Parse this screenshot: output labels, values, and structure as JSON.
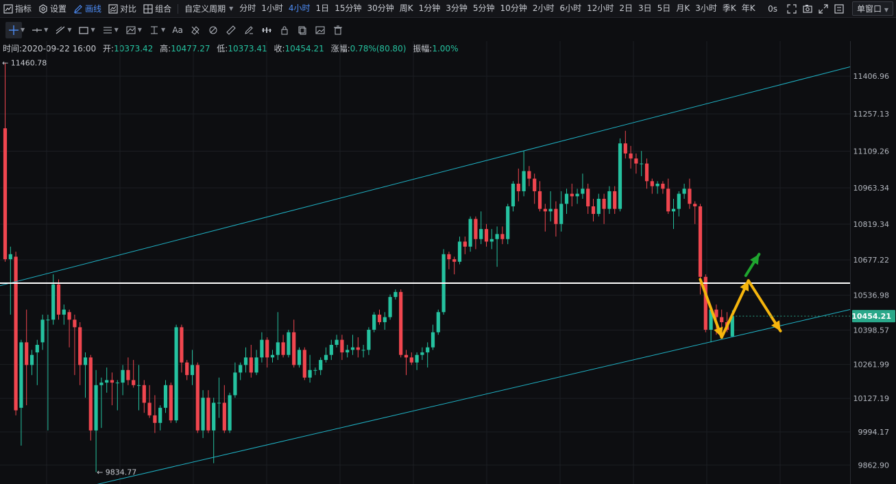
{
  "topbar": {
    "indicators": "指标",
    "settings": "设置",
    "draw": "画线",
    "compare": "对比",
    "combine": "组合",
    "custom_period": "自定义周期",
    "periods": [
      "分时",
      "1小时",
      "4小时",
      "1日",
      "15分钟",
      "30分钟",
      "周K",
      "1分钟",
      "3分钟",
      "5分钟",
      "10分钟",
      "2小时",
      "6小时",
      "12小时",
      "2日",
      "3日",
      "5日",
      "月K",
      "3小时",
      "季K",
      "年K"
    ],
    "active_period": "4小时",
    "latency": "0s",
    "window_mode": "单窗口"
  },
  "ohlc": {
    "time_label": "时间:",
    "time": "2020-09-22 16:00",
    "open_label": "开:",
    "open": "10373.42",
    "high_label": "高:",
    "high": "10477.27",
    "low_label": "低:",
    "low": "10373.41",
    "close_label": "收:",
    "close": "10454.21",
    "change_label": "涨幅:",
    "change": "0.78%(80.80)",
    "amplitude_label": "振幅:",
    "amplitude": "1.00%"
  },
  "chart_data": {
    "type": "candlestick",
    "interval": "4小时",
    "y_ticks": [
      "11406.96",
      "11257.13",
      "11109.26",
      "10963.34",
      "10819.34",
      "10677.22",
      "10536.98",
      "10398.57",
      "10261.99",
      "10127.19",
      "9994.17",
      "9862.90"
    ],
    "ylim": [
      9800,
      11520
    ],
    "max_marker": "11460.78",
    "min_marker": "9834.77",
    "last_price": "10454.21",
    "colors": {
      "up": "#25c2a0",
      "down": "#f0464f",
      "channel": "#1fb3c6",
      "level": "#ffffff",
      "arrow_projection": "#f5b50d",
      "arrow_bull": "#1fa52f",
      "last_price_bg": "#2aa88a"
    },
    "horizontal_level": 10585,
    "channel": {
      "upper": [
        {
          "i": 0,
          "price": 10580
        },
        {
          "i": 160,
          "price": 11455
        }
      ],
      "lower": [
        {
          "i": 18,
          "price": 9790
        },
        {
          "i": 160,
          "price": 10490
        }
      ]
    },
    "projection": [
      {
        "i": 130,
        "price": 10600
      },
      {
        "i": 134,
        "price": 10370
      },
      {
        "i": 139,
        "price": 10595
      },
      {
        "i": 145,
        "price": 10395
      }
    ],
    "bull_arrow": [
      {
        "i": 138.5,
        "price": 10615
      },
      {
        "i": 141,
        "price": 10700
      }
    ],
    "candles": [
      [
        11200,
        11460.78,
        10670,
        10680
      ],
      [
        10680,
        10730,
        10460,
        10700
      ],
      [
        10690,
        10710,
        10060,
        10080
      ],
      [
        10090,
        10360,
        9940,
        10350
      ],
      [
        10350,
        10480,
        10100,
        10260
      ],
      [
        10260,
        10320,
        10220,
        10300
      ],
      [
        10310,
        10360,
        10180,
        10340
      ],
      [
        10350,
        10460,
        10320,
        10440
      ],
      [
        10440,
        10460,
        10000,
        10440
      ],
      [
        10440,
        10620,
        10420,
        10580
      ],
      [
        10580,
        10600,
        10440,
        10460
      ],
      [
        10460,
        10500,
        10420,
        10480
      ],
      [
        10470,
        10480,
        10330,
        10440
      ],
      [
        10440,
        10460,
        10220,
        10410
      ],
      [
        10410,
        10430,
        10180,
        10260
      ],
      [
        10260,
        10310,
        10130,
        10290
      ],
      [
        10290,
        10300,
        9960,
        10000
      ],
      [
        10000,
        10240,
        9834.77,
        10180
      ],
      [
        10180,
        10210,
        10010,
        10190
      ],
      [
        10190,
        10250,
        10150,
        10200
      ],
      [
        10200,
        10230,
        10100,
        10190
      ],
      [
        10190,
        10200,
        10080,
        10190
      ],
      [
        10190,
        10260,
        10140,
        10240
      ],
      [
        10240,
        10290,
        10180,
        10200
      ],
      [
        10200,
        10280,
        10170,
        10180
      ],
      [
        10180,
        10260,
        10080,
        10180
      ],
      [
        10180,
        10200,
        10070,
        10110
      ],
      [
        10110,
        10180,
        10050,
        10060
      ],
      [
        10060,
        10140,
        9990,
        10030
      ],
      [
        10030,
        10100,
        10000,
        10090
      ],
      [
        10090,
        10200,
        10070,
        10180
      ],
      [
        10180,
        10190,
        10030,
        10040
      ],
      [
        10040,
        10420,
        10030,
        10410
      ],
      [
        10410,
        10420,
        10230,
        10270
      ],
      [
        10270,
        10280,
        10200,
        10220
      ],
      [
        10220,
        10320,
        10180,
        10260
      ],
      [
        10260,
        10270,
        9990,
        10000
      ],
      [
        10000,
        10160,
        9970,
        10130
      ],
      [
        10130,
        10160,
        9990,
        10000
      ],
      [
        10000,
        10130,
        9870,
        10110
      ],
      [
        10110,
        10210,
        10050,
        10110
      ],
      [
        10110,
        10180,
        9990,
        10000
      ],
      [
        10000,
        10150,
        9990,
        10140
      ],
      [
        10140,
        10270,
        10130,
        10230
      ],
      [
        10230,
        10270,
        10200,
        10260
      ],
      [
        10260,
        10330,
        10230,
        10290
      ],
      [
        10290,
        10340,
        10210,
        10230
      ],
      [
        10230,
        10320,
        10220,
        10290
      ],
      [
        10290,
        10390,
        10270,
        10360
      ],
      [
        10360,
        10370,
        10250,
        10290
      ],
      [
        10290,
        10320,
        10270,
        10300
      ],
      [
        10300,
        10470,
        10280,
        10350
      ],
      [
        10350,
        10380,
        10290,
        10300
      ],
      [
        10300,
        10400,
        10290,
        10390
      ],
      [
        10390,
        10440,
        10250,
        10260
      ],
      [
        10260,
        10330,
        10250,
        10320
      ],
      [
        10320,
        10330,
        10200,
        10210
      ],
      [
        10210,
        10300,
        10190,
        10240
      ],
      [
        10240,
        10250,
        10220,
        10240
      ],
      [
        10240,
        10290,
        10220,
        10280
      ],
      [
        10280,
        10330,
        10270,
        10300
      ],
      [
        10300,
        10360,
        10280,
        10340
      ],
      [
        10340,
        10380,
        10330,
        10360
      ],
      [
        10360,
        10380,
        10280,
        10310
      ],
      [
        10310,
        10340,
        10290,
        10320
      ],
      [
        10320,
        10380,
        10300,
        10330
      ],
      [
        10330,
        10370,
        10290,
        10320
      ],
      [
        10320,
        10340,
        10290,
        10320
      ],
      [
        10320,
        10410,
        10300,
        10400
      ],
      [
        10400,
        10470,
        10390,
        10460
      ],
      [
        10460,
        10480,
        10420,
        10430
      ],
      [
        10430,
        10470,
        10400,
        10450
      ],
      [
        10450,
        10540,
        10440,
        10530
      ],
      [
        10530,
        10560,
        10520,
        10550
      ],
      [
        10550,
        10560,
        10290,
        10300
      ],
      [
        10300,
        10320,
        10220,
        10290
      ],
      [
        10290,
        10310,
        10260,
        10270
      ],
      [
        10270,
        10310,
        10240,
        10300
      ],
      [
        10300,
        10330,
        10280,
        10310
      ],
      [
        10310,
        10350,
        10250,
        10330
      ],
      [
        10330,
        10420,
        10320,
        10390
      ],
      [
        10390,
        10480,
        10380,
        10470
      ],
      [
        10470,
        10720,
        10460,
        10700
      ],
      [
        10700,
        10710,
        10640,
        10680
      ],
      [
        10680,
        10690,
        10620,
        10670
      ],
      [
        10670,
        10770,
        10660,
        10750
      ],
      [
        10750,
        10770,
        10700,
        10730
      ],
      [
        10730,
        10850,
        10710,
        10840
      ],
      [
        10840,
        10850,
        10720,
        10760
      ],
      [
        10760,
        10870,
        10740,
        10800
      ],
      [
        10800,
        10820,
        10730,
        10750
      ],
      [
        10750,
        10800,
        10720,
        10760
      ],
      [
        10760,
        10810,
        10650,
        10780
      ],
      [
        10780,
        10810,
        10740,
        10760
      ],
      [
        10760,
        10900,
        10740,
        10890
      ],
      [
        10890,
        10990,
        10870,
        10980
      ],
      [
        10980,
        11040,
        10910,
        10950
      ],
      [
        10950,
        11110,
        10930,
        11030
      ],
      [
        11030,
        11050,
        10970,
        11000
      ],
      [
        11000,
        11020,
        10900,
        10950
      ],
      [
        10950,
        10990,
        10870,
        10880
      ],
      [
        10880,
        10900,
        10790,
        10870
      ],
      [
        10870,
        10950,
        10830,
        10880
      ],
      [
        10880,
        10910,
        10770,
        10820
      ],
      [
        10820,
        10950,
        10790,
        10900
      ],
      [
        10900,
        10960,
        10860,
        10940
      ],
      [
        10940,
        10980,
        10890,
        10930
      ],
      [
        10930,
        10960,
        10900,
        10940
      ],
      [
        10940,
        11020,
        10920,
        10960
      ],
      [
        10960,
        10980,
        10860,
        10890
      ],
      [
        10890,
        10920,
        10830,
        10860
      ],
      [
        10860,
        10940,
        10850,
        10920
      ],
      [
        10920,
        10940,
        10820,
        10880
      ],
      [
        10880,
        10970,
        10860,
        10950
      ],
      [
        10950,
        10970,
        10860,
        10880
      ],
      [
        10880,
        11160,
        10870,
        11140
      ],
      [
        11140,
        11190,
        11080,
        11100
      ],
      [
        11100,
        11130,
        11040,
        11080
      ],
      [
        11080,
        11100,
        11020,
        11060
      ],
      [
        11060,
        11110,
        11010,
        11060
      ],
      [
        11060,
        11080,
        10960,
        10990
      ],
      [
        10990,
        11000,
        10940,
        10970
      ],
      [
        10970,
        10990,
        10940,
        10980
      ],
      [
        10980,
        10990,
        10940,
        10960
      ],
      [
        10960,
        11000,
        10860,
        10870
      ],
      [
        10870,
        10920,
        10800,
        10880
      ],
      [
        10880,
        10950,
        10850,
        10940
      ],
      [
        10940,
        10980,
        10920,
        10960
      ],
      [
        10960,
        11000,
        10880,
        10900
      ],
      [
        10900,
        10910,
        10820,
        10890
      ],
      [
        10890,
        10900,
        10540,
        10610
      ],
      [
        10610,
        10620,
        10390,
        10400
      ],
      [
        10400,
        10490,
        10350,
        10480
      ],
      [
        10480,
        10500,
        10380,
        10450
      ],
      [
        10450,
        10480,
        10370,
        10430
      ],
      [
        10430,
        10470,
        10390,
        10400
      ],
      [
        10373.42,
        10477.27,
        10373.41,
        10454.21
      ]
    ]
  }
}
